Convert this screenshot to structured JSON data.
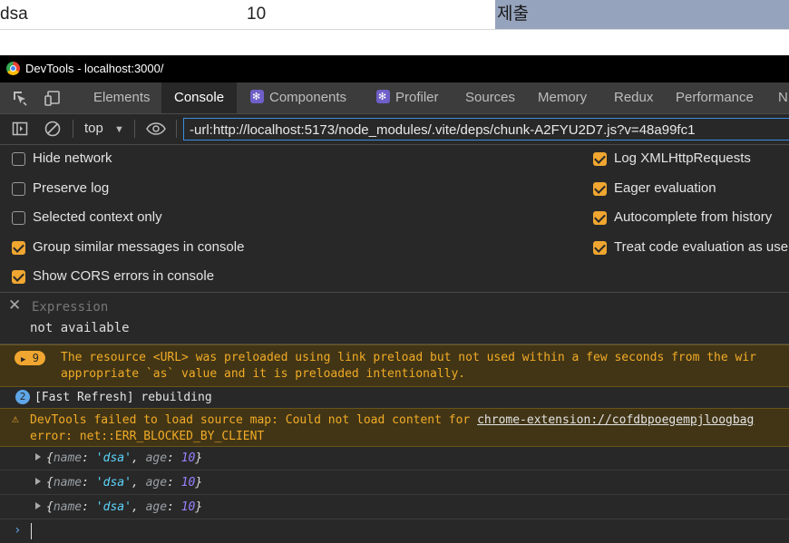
{
  "page": {
    "name_cell": "dsa",
    "age_cell": "10",
    "submit_label": "제출"
  },
  "devtools": {
    "window_title": "DevTools - localhost:3000/",
    "tabs": [
      {
        "label": "Elements"
      },
      {
        "label": "Console"
      },
      {
        "label": "Components"
      },
      {
        "label": "Profiler"
      },
      {
        "label": "Sources"
      },
      {
        "label": "Memory"
      },
      {
        "label": "Redux"
      },
      {
        "label": "Performance"
      },
      {
        "label": "N"
      }
    ],
    "context_select": "top",
    "filter_value": "-url:http://localhost:5173/node_modules/.vite/deps/chunk-A2FYU2D7.js?v=48a99fc1",
    "settings_left": [
      {
        "label": "Hide network",
        "checked": false
      },
      {
        "label": "Preserve log",
        "checked": false
      },
      {
        "label": "Selected context only",
        "checked": false
      },
      {
        "label": "Group similar messages in console",
        "checked": true
      },
      {
        "label": "Show CORS errors in console",
        "checked": true
      }
    ],
    "settings_right": [
      {
        "label": "Log XMLHttpRequests",
        "checked": true
      },
      {
        "label": "Eager evaluation",
        "checked": true
      },
      {
        "label": "Autocomplete from history",
        "checked": true
      },
      {
        "label": "Treat code evaluation as user",
        "checked": true
      }
    ],
    "expression": {
      "placeholder": "Expression",
      "value": "not available"
    },
    "messages": {
      "preload_count": "9",
      "preload_line1": "The resource <URL> was preloaded using link preload but not used within a few seconds from the wir",
      "preload_line2": "appropriate `as` value and it is preloaded intentionally.",
      "refresh_count": "2",
      "refresh_text": "[Fast Refresh] rebuilding",
      "sourcemap_line1_prefix": "DevTools failed to load source map: Could not load content for ",
      "sourcemap_link": "chrome-extension://cofdbpoegempjloogbag",
      "sourcemap_line2": "error: net::ERR_BLOCKED_BY_CLIENT"
    },
    "log_objects": [
      {
        "name": "dsa",
        "age": "10"
      },
      {
        "name": "dsa",
        "age": "10"
      },
      {
        "name": "dsa",
        "age": "10"
      }
    ]
  },
  "colors": {
    "accent_orange": "#f0a630",
    "button_bg": "#96a3bd",
    "focus_blue": "#3b8ede"
  }
}
